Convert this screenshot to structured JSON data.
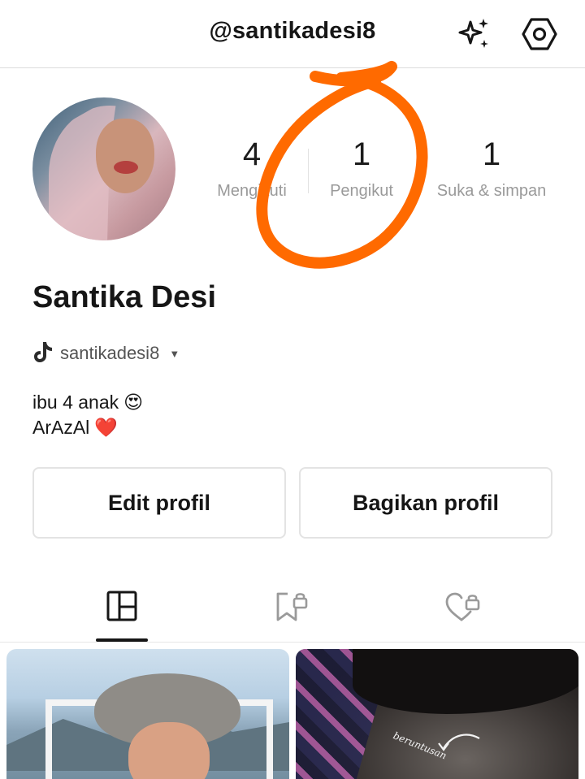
{
  "header": {
    "handle": "@santikadesi8",
    "sparkle_icon": "sparkles-icon",
    "settings_icon": "hexagon-settings-icon"
  },
  "profile": {
    "name": "Santika Desi",
    "tiktok_username": "santikadesi8",
    "bio_line1": "ibu 4 anak",
    "bio_line2": "ArAzAl",
    "bio_emoji1": "😍",
    "bio_emoji2": "❤️"
  },
  "stats": [
    {
      "value": "4",
      "label": "Mengikuti"
    },
    {
      "value": "1",
      "label": "Pengikut"
    },
    {
      "value": "1",
      "label": "Suka & simpan"
    }
  ],
  "buttons": {
    "edit": "Edit profil",
    "share": "Bagikan profil"
  },
  "tabs": [
    {
      "icon": "grid-icon",
      "active": true
    },
    {
      "icon": "bookmark-lock-icon",
      "active": false
    },
    {
      "icon": "heart-lock-icon",
      "active": false
    }
  ],
  "posts": [
    {
      "caption": ""
    },
    {
      "caption": "beruntusan"
    }
  ],
  "colors": {
    "annotation": "#ff6a00",
    "text": "#161616",
    "muted": "#9a9a9a"
  }
}
